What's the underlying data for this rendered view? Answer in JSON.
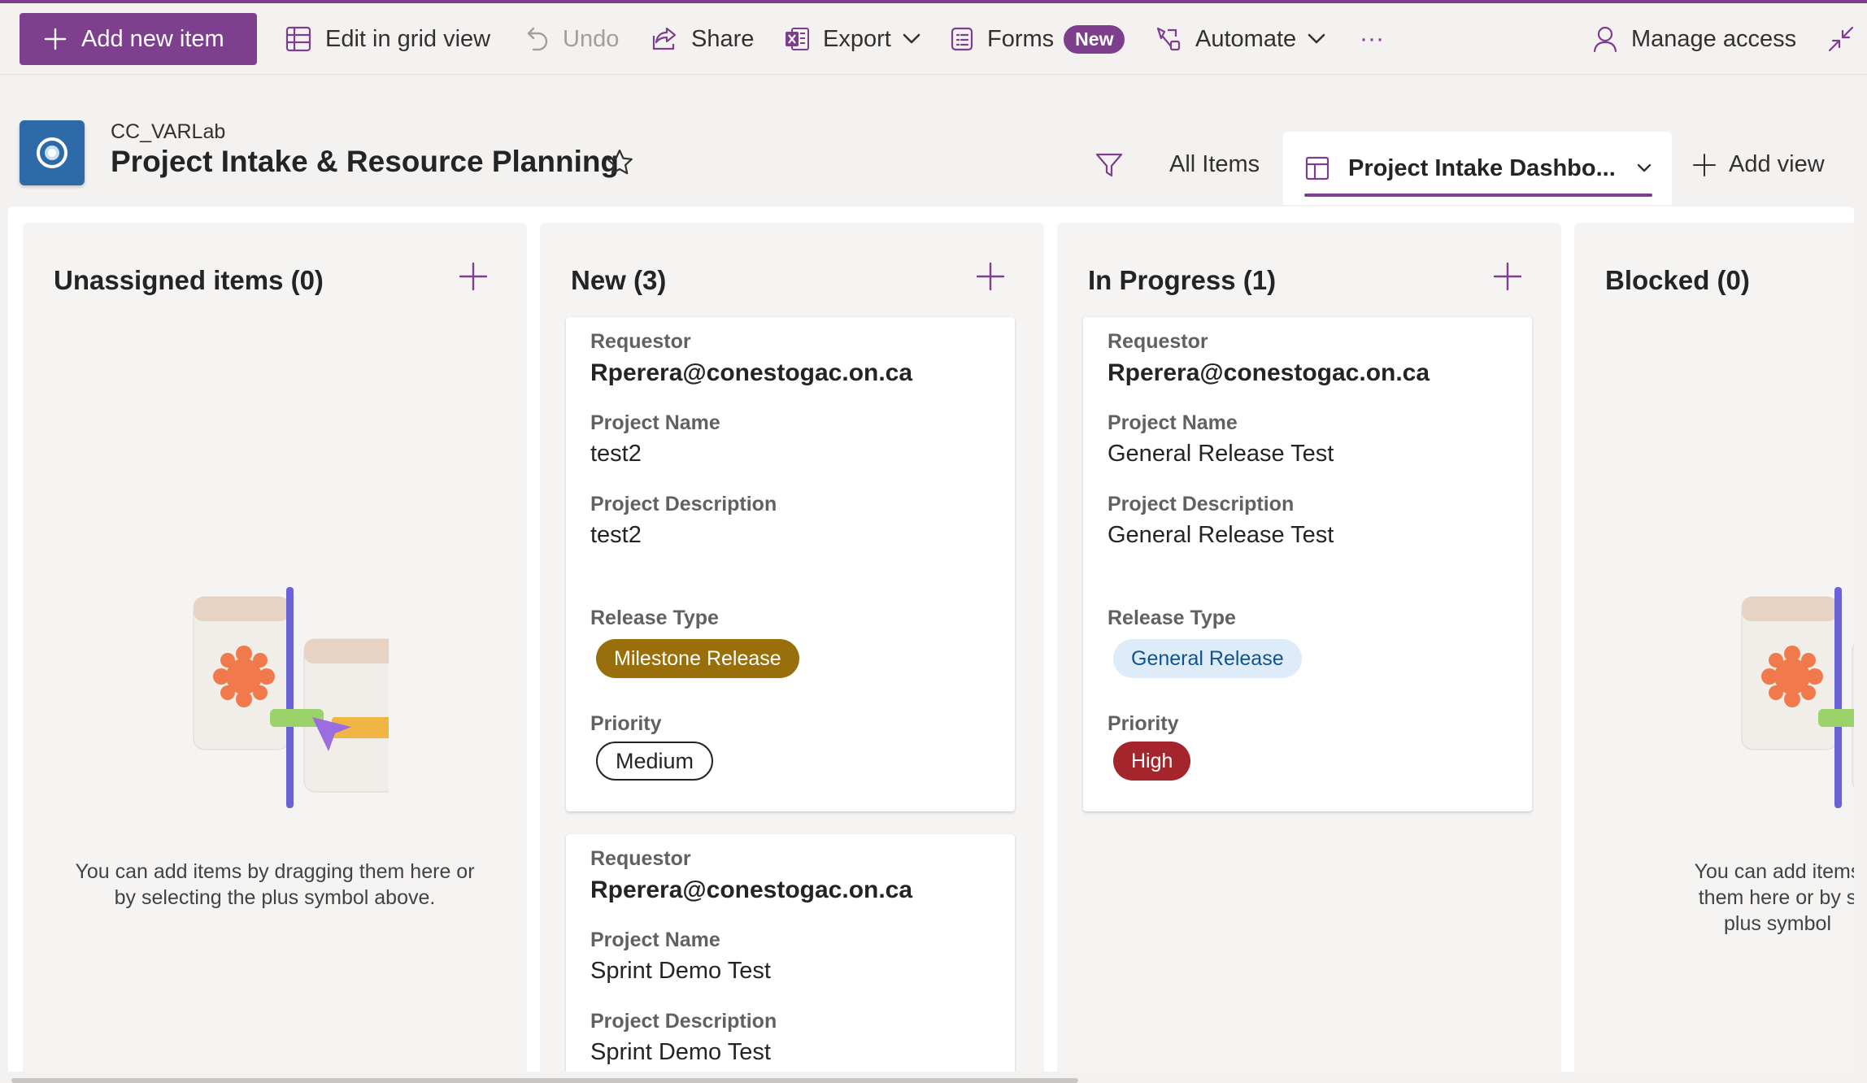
{
  "toolbar": {
    "add_new_item": "Add new item",
    "edit_grid": "Edit in grid view",
    "undo": "Undo",
    "share": "Share",
    "export": "Export",
    "forms": "Forms",
    "forms_badge": "New",
    "automate": "Automate",
    "more": "···",
    "manage_access": "Manage access"
  },
  "header": {
    "site_name": "CC_VARLab",
    "title": "Project Intake & Resource Planning"
  },
  "views": {
    "all_items": "All Items",
    "active": "Project Intake Dashbo...",
    "add_view": "Add view"
  },
  "columns": [
    {
      "title": "Unassigned items (0)",
      "empty_text": "You can add items by dragging them here or by selecting the plus symbol above."
    },
    {
      "title": "New (3)",
      "cards": [
        {
          "requestor_label": "Requestor",
          "requestor": "Rperera@conestogac.on.ca",
          "name_label": "Project Name",
          "name": "test2",
          "desc_label": "Project Description",
          "desc": "test2",
          "release_label": "Release Type",
          "release": "Milestone Release",
          "priority_label": "Priority",
          "priority": "Medium"
        },
        {
          "requestor_label": "Requestor",
          "requestor": "Rperera@conestogac.on.ca",
          "name_label": "Project Name",
          "name": "Sprint Demo Test",
          "desc_label": "Project Description",
          "desc": "Sprint Demo Test"
        }
      ]
    },
    {
      "title": "In Progress (1)",
      "cards": [
        {
          "requestor_label": "Requestor",
          "requestor": "Rperera@conestogac.on.ca",
          "name_label": "Project Name",
          "name": "General Release Test",
          "desc_label": "Project Description",
          "desc": "General Release Test",
          "release_label": "Release Type",
          "release": "General Release",
          "priority_label": "Priority",
          "priority": "High"
        }
      ]
    },
    {
      "title": "Blocked (0)",
      "empty_line1": "You can add items",
      "empty_line2": "them here or by s",
      "empty_line3": "plus symbol"
    }
  ],
  "colors": {
    "accent": "#7e3e8e",
    "milestone": "#986f0b",
    "general_bg": "#deecf9",
    "high": "#a4262c"
  }
}
